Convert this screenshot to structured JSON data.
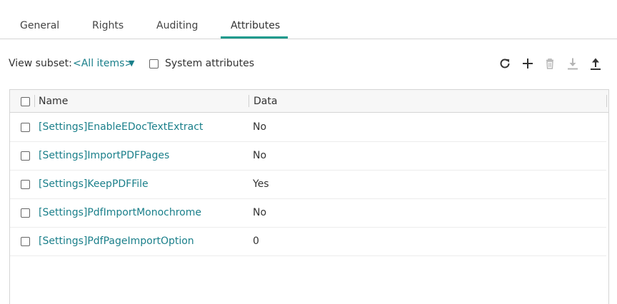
{
  "tabs": [
    {
      "label": "General",
      "active": false
    },
    {
      "label": "Rights",
      "active": false
    },
    {
      "label": "Auditing",
      "active": false
    },
    {
      "label": "Attributes",
      "active": true
    }
  ],
  "toolbar": {
    "view_subset_label": "View subset:",
    "view_subset_value": "<All items>",
    "system_attributes_label": "System attributes",
    "system_attributes_checked": false,
    "icons": [
      "refresh-icon",
      "add-icon",
      "delete-icon",
      "download-icon",
      "upload-icon"
    ]
  },
  "grid": {
    "columns": [
      "Name",
      "Data"
    ],
    "rows": [
      {
        "name": "[Settings]EnableEDocTextExtract",
        "data": "No"
      },
      {
        "name": "[Settings]ImportPDFPages",
        "data": "No"
      },
      {
        "name": "[Settings]KeepPDFFile",
        "data": "Yes"
      },
      {
        "name": "[Settings]PdfImportMonochrome",
        "data": "No"
      },
      {
        "name": "[Settings]PdfPageImportOption",
        "data": "0"
      }
    ]
  },
  "colors": {
    "accent": "#1a9a8c",
    "link": "#1a7f8a",
    "text": "#333333",
    "border": "#d5d5d5"
  }
}
